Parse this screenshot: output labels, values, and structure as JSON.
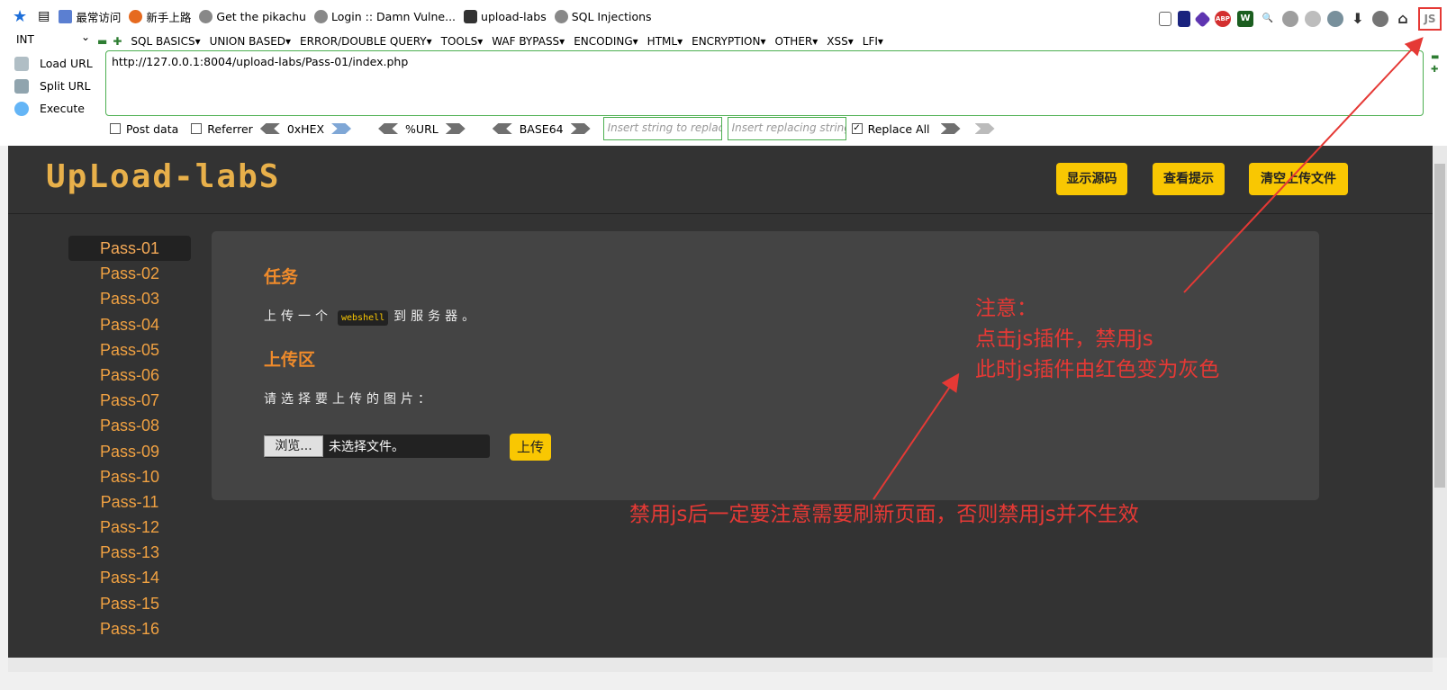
{
  "bookmarks": [
    {
      "label": "最常访问",
      "icon": "bookmarks-icon",
      "color": "#5b7fd1"
    },
    {
      "label": "新手上路",
      "icon": "firefox-icon",
      "color": "#e66a1f"
    },
    {
      "label": "Get the pikachu",
      "icon": "globe-icon",
      "color": "#777777"
    },
    {
      "label": "Login :: Damn Vulne...",
      "icon": "globe-icon",
      "color": "#777777"
    },
    {
      "label": "upload-labs",
      "icon": "folder-icon",
      "color": "#333333"
    },
    {
      "label": "SQL Injections",
      "icon": "globe-icon",
      "color": "#777777"
    }
  ],
  "toolbar": {
    "js_button": "JS"
  },
  "hackbar": {
    "select_value": "INT",
    "menu": [
      "SQL BASICS",
      "UNION BASED",
      "ERROR/DOUBLE QUERY",
      "TOOLS",
      "WAF BYPASS",
      "ENCODING",
      "HTML",
      "ENCRYPTION",
      "OTHER",
      "XSS",
      "LFI"
    ],
    "load_url": "Load URL",
    "split_url": "Split URL",
    "execute": "Execute",
    "url": "http://127.0.0.1:8004/upload-labs/Pass-01/index.php",
    "post_data": "Post data",
    "referrer": "Referrer",
    "hex": "0xHEX",
    "url_enc": "%URL",
    "base64": "BASE64",
    "replace_placeholder": "Insert string to replace",
    "replacing_placeholder": "Insert replacing string",
    "replace_all": "Replace All"
  },
  "site": {
    "logo": "UpLoad-labS",
    "buttons": [
      "显示源码",
      "查看提示",
      "清空上传文件"
    ],
    "passes": [
      "Pass-01",
      "Pass-02",
      "Pass-03",
      "Pass-04",
      "Pass-05",
      "Pass-06",
      "Pass-07",
      "Pass-08",
      "Pass-09",
      "Pass-10",
      "Pass-11",
      "Pass-12",
      "Pass-13",
      "Pass-14",
      "Pass-15",
      "Pass-16"
    ],
    "task_title": "任务",
    "task_pre": "上传一个",
    "task_code": "webshell",
    "task_post": "到服务器。",
    "upload_title": "上传区",
    "choose_label": "请选择要上传的图片：",
    "browse": "浏览...",
    "no_file": "未选择文件。",
    "upload_btn": "上传"
  },
  "annotations": {
    "note_title": "注意：",
    "note_line1": "点击js插件，禁用js",
    "note_line2": "此时js插件由红色变为灰色",
    "bottom_note": "禁用js后一定要注意需要刷新页面，否则禁用js并不生效"
  }
}
